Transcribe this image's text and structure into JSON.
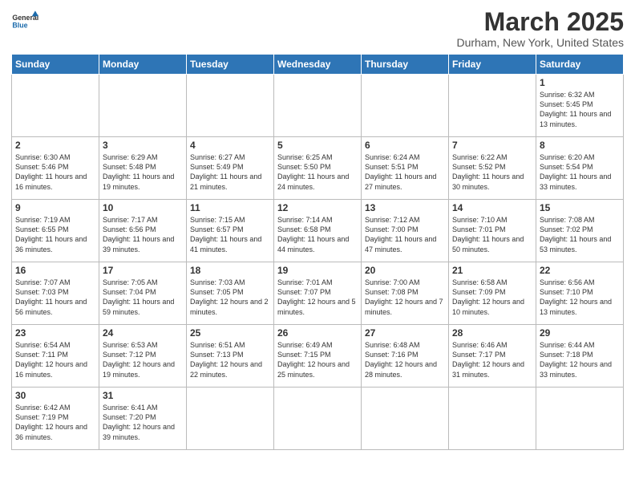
{
  "logo": {
    "general": "General",
    "blue": "Blue"
  },
  "header": {
    "title": "March 2025",
    "subtitle": "Durham, New York, United States"
  },
  "weekdays": [
    "Sunday",
    "Monday",
    "Tuesday",
    "Wednesday",
    "Thursday",
    "Friday",
    "Saturday"
  ],
  "weeks": [
    [
      {
        "day": "",
        "info": ""
      },
      {
        "day": "",
        "info": ""
      },
      {
        "day": "",
        "info": ""
      },
      {
        "day": "",
        "info": ""
      },
      {
        "day": "",
        "info": ""
      },
      {
        "day": "",
        "info": ""
      },
      {
        "day": "1",
        "info": "Sunrise: 6:32 AM\nSunset: 5:45 PM\nDaylight: 11 hours and 13 minutes."
      }
    ],
    [
      {
        "day": "2",
        "info": "Sunrise: 6:30 AM\nSunset: 5:46 PM\nDaylight: 11 hours and 16 minutes."
      },
      {
        "day": "3",
        "info": "Sunrise: 6:29 AM\nSunset: 5:48 PM\nDaylight: 11 hours and 19 minutes."
      },
      {
        "day": "4",
        "info": "Sunrise: 6:27 AM\nSunset: 5:49 PM\nDaylight: 11 hours and 21 minutes."
      },
      {
        "day": "5",
        "info": "Sunrise: 6:25 AM\nSunset: 5:50 PM\nDaylight: 11 hours and 24 minutes."
      },
      {
        "day": "6",
        "info": "Sunrise: 6:24 AM\nSunset: 5:51 PM\nDaylight: 11 hours and 27 minutes."
      },
      {
        "day": "7",
        "info": "Sunrise: 6:22 AM\nSunset: 5:52 PM\nDaylight: 11 hours and 30 minutes."
      },
      {
        "day": "8",
        "info": "Sunrise: 6:20 AM\nSunset: 5:54 PM\nDaylight: 11 hours and 33 minutes."
      }
    ],
    [
      {
        "day": "9",
        "info": "Sunrise: 7:19 AM\nSunset: 6:55 PM\nDaylight: 11 hours and 36 minutes."
      },
      {
        "day": "10",
        "info": "Sunrise: 7:17 AM\nSunset: 6:56 PM\nDaylight: 11 hours and 39 minutes."
      },
      {
        "day": "11",
        "info": "Sunrise: 7:15 AM\nSunset: 6:57 PM\nDaylight: 11 hours and 41 minutes."
      },
      {
        "day": "12",
        "info": "Sunrise: 7:14 AM\nSunset: 6:58 PM\nDaylight: 11 hours and 44 minutes."
      },
      {
        "day": "13",
        "info": "Sunrise: 7:12 AM\nSunset: 7:00 PM\nDaylight: 11 hours and 47 minutes."
      },
      {
        "day": "14",
        "info": "Sunrise: 7:10 AM\nSunset: 7:01 PM\nDaylight: 11 hours and 50 minutes."
      },
      {
        "day": "15",
        "info": "Sunrise: 7:08 AM\nSunset: 7:02 PM\nDaylight: 11 hours and 53 minutes."
      }
    ],
    [
      {
        "day": "16",
        "info": "Sunrise: 7:07 AM\nSunset: 7:03 PM\nDaylight: 11 hours and 56 minutes."
      },
      {
        "day": "17",
        "info": "Sunrise: 7:05 AM\nSunset: 7:04 PM\nDaylight: 11 hours and 59 minutes."
      },
      {
        "day": "18",
        "info": "Sunrise: 7:03 AM\nSunset: 7:05 PM\nDaylight: 12 hours and 2 minutes."
      },
      {
        "day": "19",
        "info": "Sunrise: 7:01 AM\nSunset: 7:07 PM\nDaylight: 12 hours and 5 minutes."
      },
      {
        "day": "20",
        "info": "Sunrise: 7:00 AM\nSunset: 7:08 PM\nDaylight: 12 hours and 7 minutes."
      },
      {
        "day": "21",
        "info": "Sunrise: 6:58 AM\nSunset: 7:09 PM\nDaylight: 12 hours and 10 minutes."
      },
      {
        "day": "22",
        "info": "Sunrise: 6:56 AM\nSunset: 7:10 PM\nDaylight: 12 hours and 13 minutes."
      }
    ],
    [
      {
        "day": "23",
        "info": "Sunrise: 6:54 AM\nSunset: 7:11 PM\nDaylight: 12 hours and 16 minutes."
      },
      {
        "day": "24",
        "info": "Sunrise: 6:53 AM\nSunset: 7:12 PM\nDaylight: 12 hours and 19 minutes."
      },
      {
        "day": "25",
        "info": "Sunrise: 6:51 AM\nSunset: 7:13 PM\nDaylight: 12 hours and 22 minutes."
      },
      {
        "day": "26",
        "info": "Sunrise: 6:49 AM\nSunset: 7:15 PM\nDaylight: 12 hours and 25 minutes."
      },
      {
        "day": "27",
        "info": "Sunrise: 6:48 AM\nSunset: 7:16 PM\nDaylight: 12 hours and 28 minutes."
      },
      {
        "day": "28",
        "info": "Sunrise: 6:46 AM\nSunset: 7:17 PM\nDaylight: 12 hours and 31 minutes."
      },
      {
        "day": "29",
        "info": "Sunrise: 6:44 AM\nSunset: 7:18 PM\nDaylight: 12 hours and 33 minutes."
      }
    ],
    [
      {
        "day": "30",
        "info": "Sunrise: 6:42 AM\nSunset: 7:19 PM\nDaylight: 12 hours and 36 minutes."
      },
      {
        "day": "31",
        "info": "Sunrise: 6:41 AM\nSunset: 7:20 PM\nDaylight: 12 hours and 39 minutes."
      },
      {
        "day": "",
        "info": ""
      },
      {
        "day": "",
        "info": ""
      },
      {
        "day": "",
        "info": ""
      },
      {
        "day": "",
        "info": ""
      },
      {
        "day": "",
        "info": ""
      }
    ]
  ]
}
